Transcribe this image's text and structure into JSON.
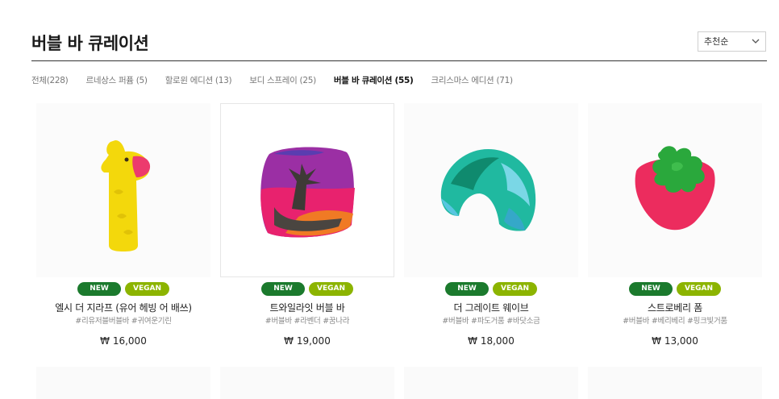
{
  "page": {
    "title": "버블 바 큐레이션",
    "sort": {
      "selected": "추천순"
    }
  },
  "tabs": [
    {
      "label": "전체(228)",
      "active": false
    },
    {
      "label": "르네상스 퍼퓸 (5)",
      "active": false
    },
    {
      "label": "할로윈 에디션 (13)",
      "active": false
    },
    {
      "label": "보디 스프레이 (25)",
      "active": false
    },
    {
      "label": "버블 바 큐레이션 (55)",
      "active": true
    },
    {
      "label": "크리스마스 에디션 (71)",
      "active": false
    }
  ],
  "badges": {
    "new": "NEW",
    "vegan": "VEGAN"
  },
  "products": [
    {
      "name": "엘시 더 지라프 (유어 헤빙 어 배쓰)",
      "tags": "#리유저블버블바 #귀여운기린",
      "price": "₩ 16,000",
      "image": "giraffe-bubble-bar"
    },
    {
      "name": "트와일라잇 버블 바",
      "tags": "#버블바 #라벤더 #꿈나라",
      "price": "₩ 19,000",
      "image": "twilight-bubble-bar"
    },
    {
      "name": "더 그레이트 웨이브",
      "tags": "#버블바 #파도거품 #바닷소금",
      "price": "₩ 18,000",
      "image": "wave-bubble-bar"
    },
    {
      "name": "스트로베리 폼",
      "tags": "#버블바 #베리베리 #핑크빛거품",
      "price": "₩ 13,000",
      "image": "strawberry-bubble-bar"
    }
  ],
  "colors": {
    "new_badge": "#1b7a2d",
    "vegan_badge": "#8cb400",
    "active_tab": "#111111"
  }
}
